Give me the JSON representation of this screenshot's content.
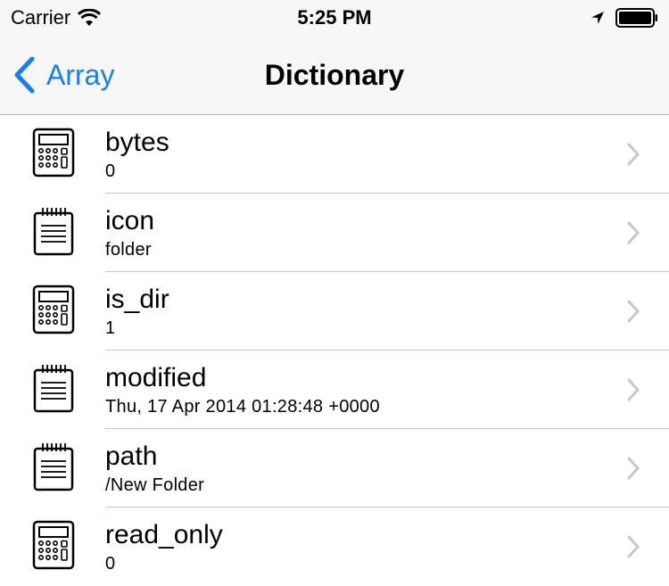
{
  "status_bar": {
    "carrier": "Carrier",
    "time": "5:25 PM",
    "icons": [
      "wifi-icon",
      "location-arrow-icon",
      "battery-icon"
    ]
  },
  "nav": {
    "back_label": "Array",
    "title": "Dictionary"
  },
  "accent_color": "#157efb",
  "rows": [
    {
      "key": "bytes",
      "value": "0",
      "icon": "calculator-icon"
    },
    {
      "key": "icon",
      "value": "folder",
      "icon": "notepad-icon"
    },
    {
      "key": "is_dir",
      "value": "1",
      "icon": "calculator-icon"
    },
    {
      "key": "modified",
      "value": "Thu, 17 Apr 2014 01:28:48 +0000",
      "icon": "notepad-icon"
    },
    {
      "key": "path",
      "value": "/New Folder",
      "icon": "notepad-icon"
    },
    {
      "key": "read_only",
      "value": "0",
      "icon": "calculator-icon"
    }
  ]
}
